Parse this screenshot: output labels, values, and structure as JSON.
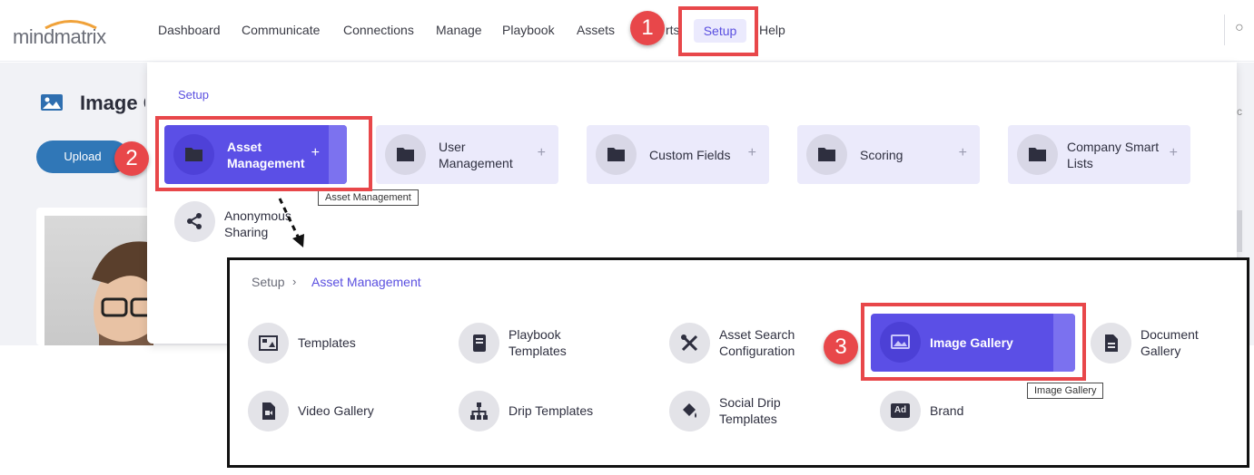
{
  "topnav": {
    "logo_text": "mindmatrix",
    "items": [
      "Dashboard",
      "Communicate",
      "Connections",
      "Manage",
      "Playbook",
      "Assets",
      "rts",
      "Help"
    ],
    "active_item": "Setup"
  },
  "background_page": {
    "title": "Image G",
    "upload_label": "Upload"
  },
  "setup_panel": {
    "label": "Setup",
    "tiles": [
      {
        "label": "Asset\nManagement",
        "plus": "+"
      },
      {
        "label": "User\nManagement",
        "plus": "+"
      },
      {
        "label": "Custom Fields",
        "plus": "+"
      },
      {
        "label": "Scoring",
        "plus": "+"
      },
      {
        "label": "Company Smart\nLists",
        "plus": "+"
      }
    ],
    "second_row": [
      {
        "label": "Anonymous\nSharing"
      }
    ],
    "tooltip": "Asset Management"
  },
  "annotations": {
    "steps": [
      "1",
      "2",
      "3"
    ]
  },
  "inset": {
    "breadcrumb": {
      "root": "Setup",
      "separator": "›",
      "current": "Asset Management"
    },
    "items": [
      {
        "label": "Templates",
        "icon": "templates-icon"
      },
      {
        "label": "Playbook\nTemplates",
        "icon": "book-icon"
      },
      {
        "label": "Asset Search\nConfiguration",
        "icon": "tools-icon"
      },
      {
        "label": "Image Gallery",
        "icon": "image-icon"
      },
      {
        "label": "Document\nGallery",
        "icon": "document-icon"
      },
      {
        "label": "Video Gallery",
        "icon": "video-file-icon"
      },
      {
        "label": "Drip Templates",
        "icon": "sitemap-icon"
      },
      {
        "label": "Social Drip\nTemplates",
        "icon": "paint-bucket-icon"
      },
      {
        "label": "Brand",
        "icon": "ad-icon"
      }
    ],
    "tooltip": "Image Gallery",
    "ad_icon_text": "Ad"
  },
  "colors": {
    "accent": "#5b4fe6",
    "annotation_red": "#e8474a",
    "upload_blue": "#3077b7"
  }
}
